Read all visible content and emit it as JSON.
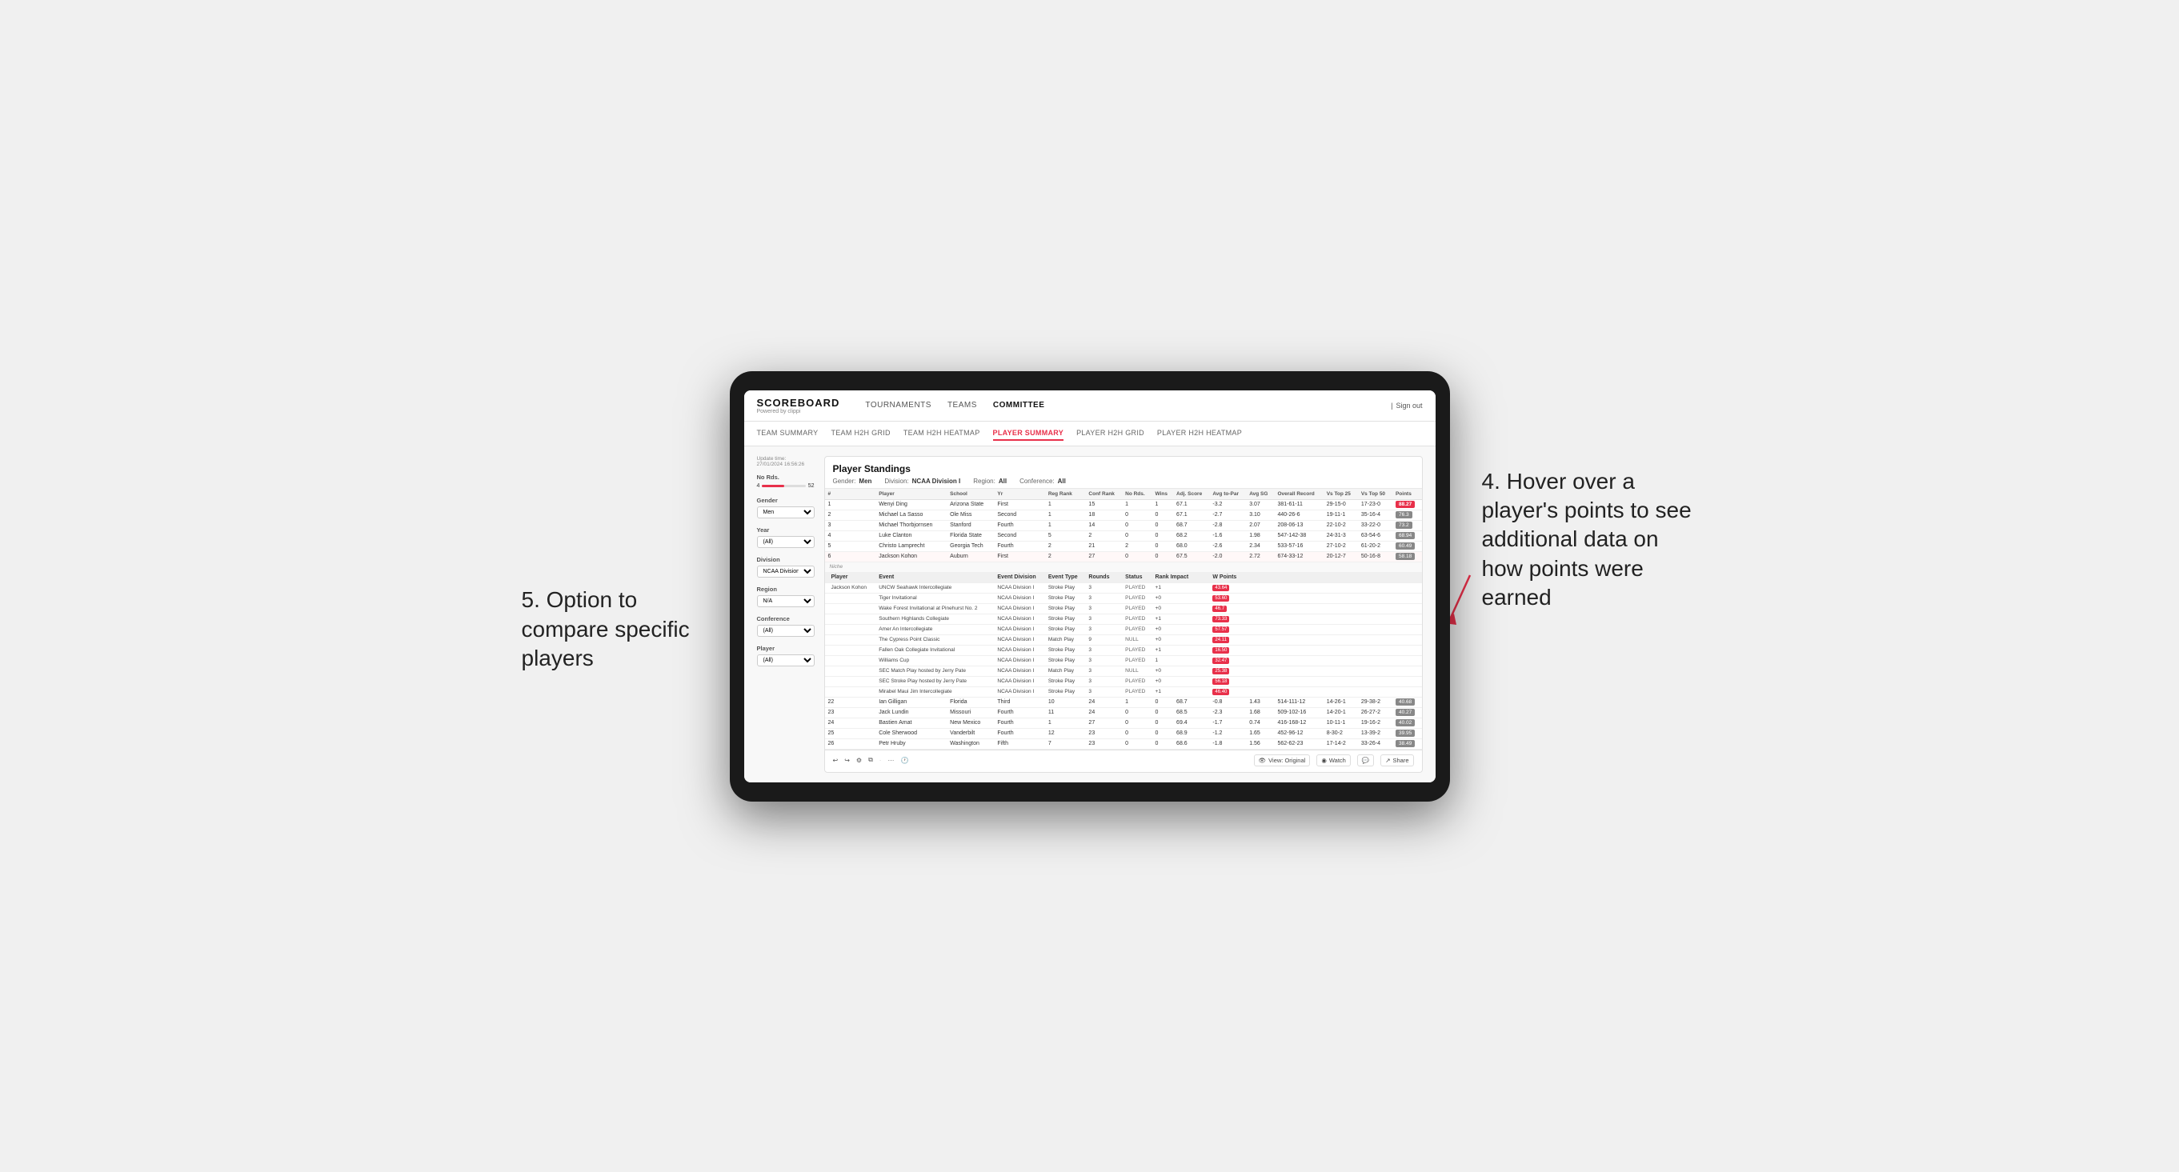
{
  "annotations": {
    "top_right": "4. Hover over a player's points to see additional data on how points were earned",
    "bottom_left": "5. Option to compare specific players"
  },
  "header": {
    "logo": "SCOREBOARD",
    "logo_sub": "Powered by clippi",
    "nav": [
      "TOURNAMENTS",
      "TEAMS",
      "COMMITTEE"
    ],
    "sign_out": "Sign out"
  },
  "sub_nav": {
    "items": [
      "TEAM SUMMARY",
      "TEAM H2H GRID",
      "TEAM H2H HEATMAP",
      "PLAYER SUMMARY",
      "PLAYER H2H GRID",
      "PLAYER H2H HEATMAP"
    ],
    "active": "PLAYER SUMMARY"
  },
  "filters": {
    "update_time_label": "Update time:",
    "update_time": "27/01/2024 16:56:26",
    "no_rds_label": "No Rds.",
    "no_rds_min": "4",
    "no_rds_max": "52",
    "gender_label": "Gender",
    "gender_value": "Men",
    "year_label": "Year",
    "year_value": "(All)",
    "division_label": "Division",
    "division_value": "NCAA Division I",
    "region_label": "Region",
    "region_value": "N/A",
    "conference_label": "Conference",
    "conference_value": "(All)",
    "player_label": "Player",
    "player_value": "(All)"
  },
  "standings": {
    "title": "Player Standings",
    "gender": "Men",
    "division": "NCAA Division I",
    "region": "All",
    "conference": "All",
    "columns": [
      "#",
      "Player",
      "School",
      "Yr",
      "Reg Rank",
      "Conf Rank",
      "No Rds.",
      "Wins",
      "Adj. Score",
      "Avg to-Par",
      "Avg SG",
      "Overall Record",
      "Vs Top 25",
      "Vs Top 50",
      "Points"
    ],
    "players": [
      {
        "rank": 1,
        "name": "Wenyi Ding",
        "school": "Arizona State",
        "yr": "First",
        "reg_rank": 1,
        "conf_rank": 15,
        "no_rds": 1,
        "wins": 1,
        "adj_score": 67.1,
        "avg_to_par": -3.2,
        "avg_sg": 3.07,
        "overall": "381-61-11",
        "vs25": "29-15-0",
        "vs50": "17-23-0",
        "points": "88.27",
        "points_highlight": true
      },
      {
        "rank": 2,
        "name": "Michael La Sasso",
        "school": "Ole Miss",
        "yr": "Second",
        "reg_rank": 1,
        "conf_rank": 18,
        "no_rds": 0,
        "wins": 0,
        "adj_score": 67.1,
        "avg_to_par": -2.7,
        "avg_sg": 3.1,
        "overall": "440-26-6",
        "vs25": "19-11-1",
        "vs50": "35-16-4",
        "points": "76.3"
      },
      {
        "rank": 3,
        "name": "Michael Thorbjornsen",
        "school": "Stanford",
        "yr": "Fourth",
        "reg_rank": 1,
        "conf_rank": 14,
        "no_rds": 0,
        "wins": 0,
        "adj_score": 68.7,
        "avg_to_par": -2.8,
        "avg_sg": 2.07,
        "overall": "208-06-13",
        "vs25": "22-10-2",
        "vs50": "33-22-0",
        "points": "73.2"
      },
      {
        "rank": 4,
        "name": "Luke Clanton",
        "school": "Florida State",
        "yr": "Second",
        "reg_rank": 5,
        "conf_rank": 2,
        "no_rds": 0,
        "wins": 0,
        "adj_score": 68.2,
        "avg_to_par": -1.6,
        "avg_sg": 1.98,
        "overall": "547-142-38",
        "vs25": "24-31-3",
        "vs50": "63-54-6",
        "points": "68.94"
      },
      {
        "rank": 5,
        "name": "Christo Lamprecht",
        "school": "Georgia Tech",
        "yr": "Fourth",
        "reg_rank": 2,
        "conf_rank": 21,
        "no_rds": 0,
        "wins": 0,
        "adj_score": 68.0,
        "avg_to_par": -2.6,
        "avg_sg": 2.34,
        "overall": "533-57-16",
        "vs25": "27-10-2",
        "vs50": "61-20-2",
        "points": "60.49"
      },
      {
        "rank": 6,
        "name": "Jackson Kohon",
        "school": "Auburn",
        "yr": "First",
        "reg_rank": 2,
        "conf_rank": 27,
        "no_rds": 0,
        "wins": 0,
        "adj_score": 67.5,
        "avg_to_par": -2.0,
        "avg_sg": 2.72,
        "overall": "674-33-12",
        "vs25": "20-12-7",
        "vs50": "50-16-8",
        "points": "58.18",
        "has_tooltip": true
      }
    ],
    "event_detail_header": [
      "Player",
      "Event",
      "Event Division",
      "Event Type",
      "Rounds",
      "Status",
      "Rank Impact",
      "W Points"
    ],
    "event_rows": [
      {
        "player": "Jackson Kohon",
        "event": "UNCW Seahawk Intercollegiate",
        "division": "NCAA Division I",
        "type": "Stroke Play",
        "rounds": 3,
        "status": "PLAYED",
        "rank_impact": "+1",
        "w_points": "43.64"
      },
      {
        "player": "",
        "event": "Tiger Invitational",
        "division": "NCAA Division I",
        "type": "Stroke Play",
        "rounds": 3,
        "status": "PLAYED",
        "rank_impact": "+0",
        "w_points": "53.60"
      },
      {
        "player": "",
        "event": "Wake Forest Invitational at Pinehurst No. 2",
        "division": "NCAA Division I",
        "type": "Stroke Play",
        "rounds": 3,
        "status": "PLAYED",
        "rank_impact": "+0",
        "w_points": "46.7"
      },
      {
        "player": "",
        "event": "Southern Highlands Collegiate",
        "division": "NCAA Division I",
        "type": "Stroke Play",
        "rounds": 3,
        "status": "PLAYED",
        "rank_impact": "+1",
        "w_points": "73.33"
      },
      {
        "player": "",
        "event": "Amer An Intercollegiate",
        "division": "NCAA Division I",
        "type": "Stroke Play",
        "rounds": 3,
        "status": "PLAYED",
        "rank_impact": "+0",
        "w_points": "57.57"
      },
      {
        "player": "",
        "event": "The Cypress Point Classic",
        "division": "NCAA Division I",
        "type": "Match Play",
        "rounds": 9,
        "status": "NULL",
        "rank_impact": "+0",
        "w_points": "24.11"
      },
      {
        "player": "",
        "event": "Fallen Oak Collegiate Invitational",
        "division": "NCAA Division I",
        "type": "Stroke Play",
        "rounds": 3,
        "status": "PLAYED",
        "rank_impact": "+1",
        "w_points": "16.50"
      },
      {
        "player": "",
        "event": "Williams Cup",
        "division": "NCAA Division I",
        "type": "Stroke Play",
        "rounds": 3,
        "status": "PLAYED",
        "rank_impact": "1",
        "w_points": "32.47"
      },
      {
        "player": "",
        "event": "SEC Match Play hosted by Jerry Pate",
        "division": "NCAA Division I",
        "type": "Match Play",
        "rounds": 3,
        "status": "NULL",
        "rank_impact": "+0",
        "w_points": "25.38"
      },
      {
        "player": "",
        "event": "SEC Stroke Play hosted by Jerry Pate",
        "division": "NCAA Division I",
        "type": "Stroke Play",
        "rounds": 3,
        "status": "PLAYED",
        "rank_impact": "+0",
        "w_points": "56.18"
      },
      {
        "player": "",
        "event": "Mirabel Maui Jim Intercollegiate",
        "division": "NCAA Division I",
        "type": "Stroke Play",
        "rounds": 3,
        "status": "PLAYED",
        "rank_impact": "+1",
        "w_points": "46.40"
      }
    ],
    "more_players": [
      {
        "rank": 22,
        "name": "Ian Gilligan",
        "school": "Florida",
        "yr": "Third",
        "reg_rank": 10,
        "conf_rank": 24,
        "no_rds": 1,
        "wins": 0,
        "adj_score": 68.7,
        "avg_to_par": -0.8,
        "avg_sg": 1.43,
        "overall": "514-111-12",
        "vs25": "14-26-1",
        "vs50": "29-38-2",
        "points": "40.68"
      },
      {
        "rank": 23,
        "name": "Jack Lundin",
        "school": "Missouri",
        "yr": "Fourth",
        "reg_rank": 11,
        "conf_rank": 24,
        "no_rds": 0,
        "wins": 0,
        "adj_score": 68.5,
        "avg_to_par": -2.3,
        "avg_sg": 1.68,
        "overall": "509-102-16",
        "vs25": "14-20-1",
        "vs50": "26-27-2",
        "points": "40.27"
      },
      {
        "rank": 24,
        "name": "Bastien Amat",
        "school": "New Mexico",
        "yr": "Fourth",
        "reg_rank": 1,
        "conf_rank": 27,
        "no_rds": 0,
        "wins": 0,
        "adj_score": 69.4,
        "avg_to_par": -1.7,
        "avg_sg": 0.74,
        "overall": "416-168-12",
        "vs25": "10-11-1",
        "vs50": "19-16-2",
        "points": "40.02"
      },
      {
        "rank": 25,
        "name": "Cole Sherwood",
        "school": "Vanderbilt",
        "yr": "Fourth",
        "reg_rank": 12,
        "conf_rank": 23,
        "no_rds": 0,
        "wins": 0,
        "adj_score": 68.9,
        "avg_to_par": -1.2,
        "avg_sg": 1.65,
        "overall": "452-96-12",
        "vs25": "8-30-2",
        "vs50": "13-39-2",
        "points": "39.95"
      },
      {
        "rank": 26,
        "name": "Petr Hruby",
        "school": "Washington",
        "yr": "Fifth",
        "reg_rank": 7,
        "conf_rank": 23,
        "no_rds": 0,
        "wins": 0,
        "adj_score": 68.6,
        "avg_to_par": -1.8,
        "avg_sg": 1.56,
        "overall": "562-62-23",
        "vs25": "17-14-2",
        "vs50": "33-26-4",
        "points": "38.49"
      }
    ]
  },
  "toolbar": {
    "view_original": "View: Original",
    "watch": "Watch",
    "share": "Share"
  }
}
